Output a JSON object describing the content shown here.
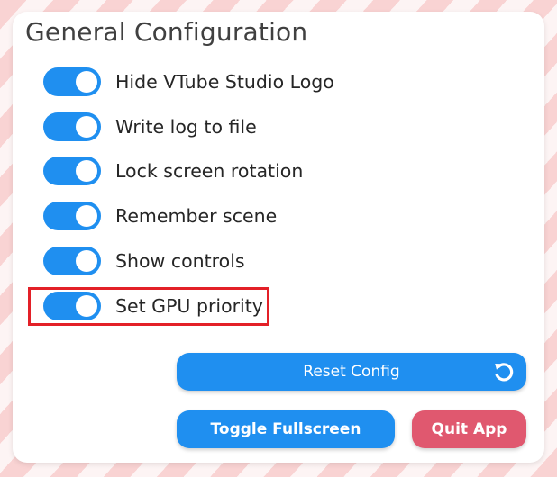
{
  "panel": {
    "title": "General Configuration"
  },
  "settings": [
    {
      "label": "Hide VTube Studio Logo",
      "enabled": true
    },
    {
      "label": "Write log to file",
      "enabled": true
    },
    {
      "label": "Lock screen rotation",
      "enabled": true
    },
    {
      "label": "Remember scene",
      "enabled": true
    },
    {
      "label": "Show controls",
      "enabled": true
    },
    {
      "label": "Set GPU priority",
      "enabled": true
    }
  ],
  "buttons": {
    "reset_config": "Reset Config",
    "reset_icon": "reset-icon",
    "toggle_fullscreen": "Toggle Fullscreen",
    "quit_app": "Quit App"
  },
  "colors": {
    "toggle_on": "#1f8ff0",
    "primary_button": "#1f8ff0",
    "danger_button": "#e0586f",
    "highlight_box": "#e32028",
    "background_pink": "#f9d3d3"
  }
}
